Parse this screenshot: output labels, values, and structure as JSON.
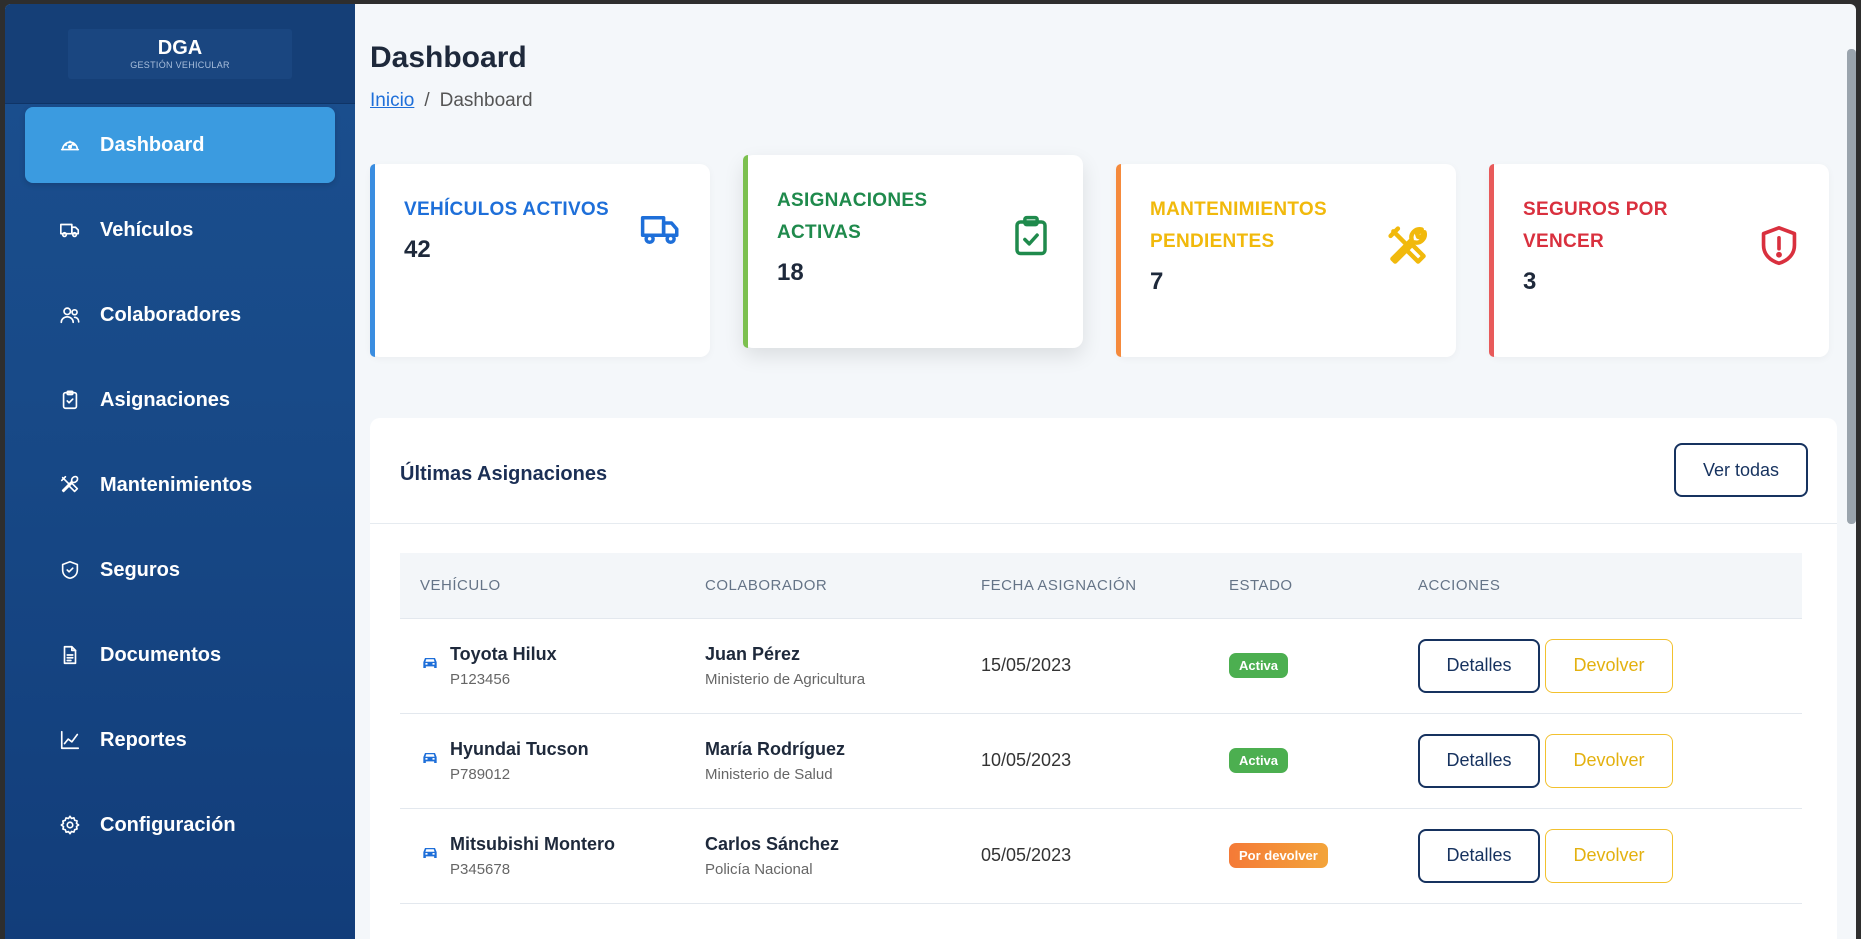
{
  "brand": {
    "name": "DGA",
    "tagline": "GESTIÓN VEHICULAR"
  },
  "sidebar": {
    "items": [
      {
        "label": "Dashboard",
        "icon": "gauge-icon",
        "active": true
      },
      {
        "label": "Vehículos",
        "icon": "truck-icon"
      },
      {
        "label": "Colaboradores",
        "icon": "users-icon"
      },
      {
        "label": "Asignaciones",
        "icon": "clipboard-check-icon"
      },
      {
        "label": "Mantenimientos",
        "icon": "tools-icon"
      },
      {
        "label": "Seguros",
        "icon": "shield-check-icon"
      },
      {
        "label": "Documentos",
        "icon": "document-icon"
      },
      {
        "label": "Reportes",
        "icon": "line-chart-icon"
      },
      {
        "label": "Configuración",
        "icon": "gear-icon"
      }
    ]
  },
  "header": {
    "title": "Dashboard",
    "breadcrumb": {
      "home": "Inicio",
      "separator": "/",
      "current": "Dashboard"
    }
  },
  "stats": [
    {
      "label": "VEHÍCULOS ACTIVOS",
      "value": "42",
      "color": "#1e6fd9",
      "bar": "#3a8de0",
      "icon": "truck-icon"
    },
    {
      "label": "ASIGNACIONES ACTIVAS",
      "value": "18",
      "color": "#1f8a4c",
      "bar": "#7cc04f",
      "icon": "clipboard-check-icon"
    },
    {
      "label": "MANTENIMIENTOS PENDIENTES",
      "value": "7",
      "color": "#f1b90c",
      "bar": "#f58a3c",
      "icon": "tools-icon"
    },
    {
      "label": "SEGUROS POR VENCER",
      "value": "3",
      "color": "#d9303e",
      "bar": "#e85a5a",
      "icon": "shield-alert-icon"
    }
  ],
  "assignments": {
    "title": "Últimas Asignaciones",
    "view_all": "Ver todas",
    "columns": [
      "VEHÍCULO",
      "COLABORADOR",
      "FECHA ASIGNACIÓN",
      "ESTADO",
      "ACCIONES"
    ],
    "rows": [
      {
        "vehicle": "Toyota Hilux",
        "plate": "P123456",
        "person": "Juan Pérez",
        "org": "Ministerio de Agricultura",
        "date": "15/05/2023",
        "status": "Activa",
        "status_color": "green"
      },
      {
        "vehicle": "Hyundai Tucson",
        "plate": "P789012",
        "person": "María Rodríguez",
        "org": "Ministerio de Salud",
        "date": "10/05/2023",
        "status": "Activa",
        "status_color": "green"
      },
      {
        "vehicle": "Mitsubishi Montero",
        "plate": "P345678",
        "person": "Carlos Sánchez",
        "org": "Policía Nacional",
        "date": "05/05/2023",
        "status": "Por devolver",
        "status_color": "orange"
      }
    ],
    "details_label": "Detalles",
    "return_label": "Devolver"
  }
}
